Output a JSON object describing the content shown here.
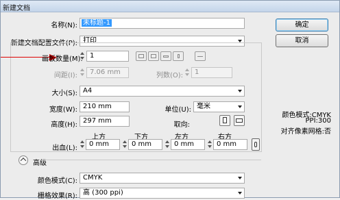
{
  "window": {
    "title": "新建文档"
  },
  "fields": {
    "name_label": "名称(N):",
    "name_value": "未标题-1",
    "profile_label": "新建文档配置文件(P):",
    "profile_value": "打印",
    "artboards_label": "画板数量(M):",
    "artboards_value": "1",
    "spacing_label": "间距(I):",
    "spacing_value": "7.06 mm",
    "columns_label": "列数(O):",
    "columns_value": "1",
    "size_label": "大小(S):",
    "size_value": "A4",
    "width_label": "宽度(W):",
    "width_value": "210 mm",
    "units_label": "单位(U):",
    "units_value": "毫米",
    "height_label": "高度(H):",
    "height_value": "297 mm",
    "orientation_label": "取向:",
    "bleed_label": "出血(L):",
    "bleed_top_label": "上方",
    "bleed_bottom_label": "下方",
    "bleed_left_label": "左方",
    "bleed_right_label": "右方",
    "bleed_top": "0 mm",
    "bleed_bottom": "0 mm",
    "bleed_left": "0 mm",
    "bleed_right": "0 mm",
    "advanced_label": "高级",
    "color_mode_label": "颜色模式(C):",
    "color_mode_value": "CMYK",
    "raster_label": "栅格效果(R):",
    "raster_value": "高 (300 ppi)"
  },
  "buttons": {
    "ok": "确定",
    "cancel": "取消"
  },
  "info": {
    "color_mode": "颜色模式:CMYK",
    "ppi": "PPI:300",
    "align_pixel": "对齐像素网格:否"
  },
  "icons": [
    "grid-by-row-icon",
    "grid-by-column-icon",
    "arrange-by-row-icon",
    "arrange-by-column-icon",
    "right-to-left-icon",
    "portrait-icon",
    "landscape-icon",
    "link-bleed-icon",
    "advanced-collapse-icon"
  ],
  "colors": {
    "annotation_arrow": "#dd0000",
    "default_button_border": "#3c7fb1"
  }
}
